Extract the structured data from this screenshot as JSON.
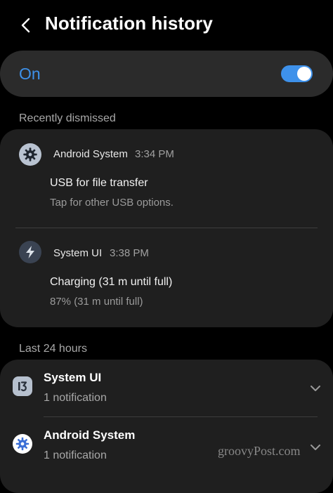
{
  "header": {
    "title": "Notification history"
  },
  "toggle": {
    "label": "On",
    "state": "on",
    "accent_color": "#3e91ea"
  },
  "recently_dismissed": {
    "label": "Recently dismissed",
    "items": [
      {
        "app": "Android System",
        "time": "3:34 PM",
        "title": "USB for file transfer",
        "text": "Tap for other USB options.",
        "icon": "gear-icon"
      },
      {
        "app": "System UI",
        "time": "3:38 PM",
        "title": "Charging (31 m until full)",
        "text": "87% (31 m until full)",
        "icon": "bolt-icon"
      }
    ]
  },
  "last_24_hours": {
    "label": "Last 24 hours",
    "groups": [
      {
        "app": "System UI",
        "count": "1 notification",
        "icon": "system-ui-icon"
      },
      {
        "app": "Android System",
        "count": "1 notification",
        "icon": "android-system-icon"
      }
    ]
  },
  "watermark": "groovyPost.com"
}
